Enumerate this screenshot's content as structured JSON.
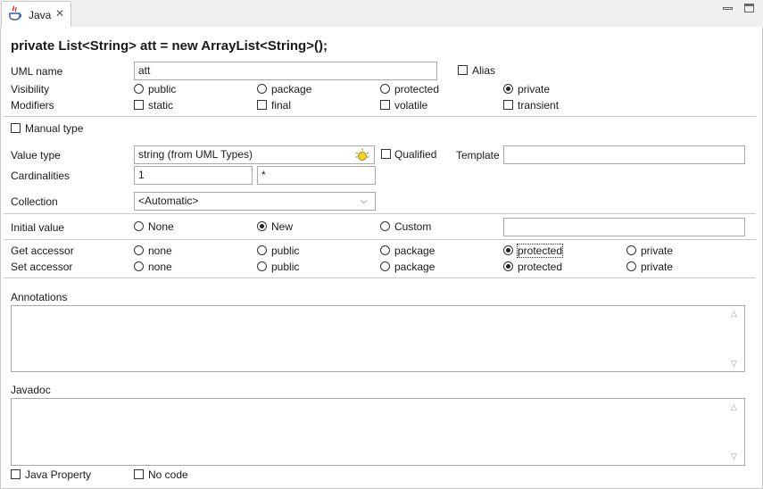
{
  "tab": {
    "label": "Java"
  },
  "header": {
    "declaration": "private List<String> att = new ArrayList<String>();"
  },
  "uml_name": {
    "label": "UML name",
    "value": "att"
  },
  "alias": {
    "label": "Alias",
    "checked": false
  },
  "visibility": {
    "label": "Visibility",
    "options": [
      "public",
      "package",
      "protected",
      "private"
    ],
    "selected": "private"
  },
  "modifiers": {
    "label": "Modifiers",
    "options": [
      "static",
      "final",
      "volatile",
      "transient"
    ]
  },
  "manual_type": {
    "label": "Manual type",
    "checked": false
  },
  "value_type": {
    "label": "Value type",
    "value": "string  (from UML Types)",
    "icon": "lightbulb-icon"
  },
  "qualified": {
    "label": "Qualified",
    "checked": false
  },
  "template": {
    "label": "Template",
    "value": ""
  },
  "cardinalities": {
    "label": "Cardinalities",
    "min": "1",
    "max": "*"
  },
  "collection": {
    "label": "Collection",
    "value": "<Automatic>"
  },
  "initial_value": {
    "label": "Initial value",
    "options": [
      "None",
      "New",
      "Custom"
    ],
    "selected": "New",
    "custom_value": ""
  },
  "get_accessor": {
    "label": "Get accessor",
    "options": [
      "none",
      "public",
      "package",
      "protected",
      "private"
    ],
    "selected": "protected"
  },
  "set_accessor": {
    "label": "Set accessor",
    "options": [
      "none",
      "public",
      "package",
      "protected",
      "private"
    ],
    "selected": "protected"
  },
  "annotations": {
    "label": "Annotations",
    "value": ""
  },
  "javadoc": {
    "label": "Javadoc",
    "value": ""
  },
  "java_property": {
    "label": "Java Property",
    "checked": false
  },
  "no_code": {
    "label": "No code",
    "checked": false
  }
}
